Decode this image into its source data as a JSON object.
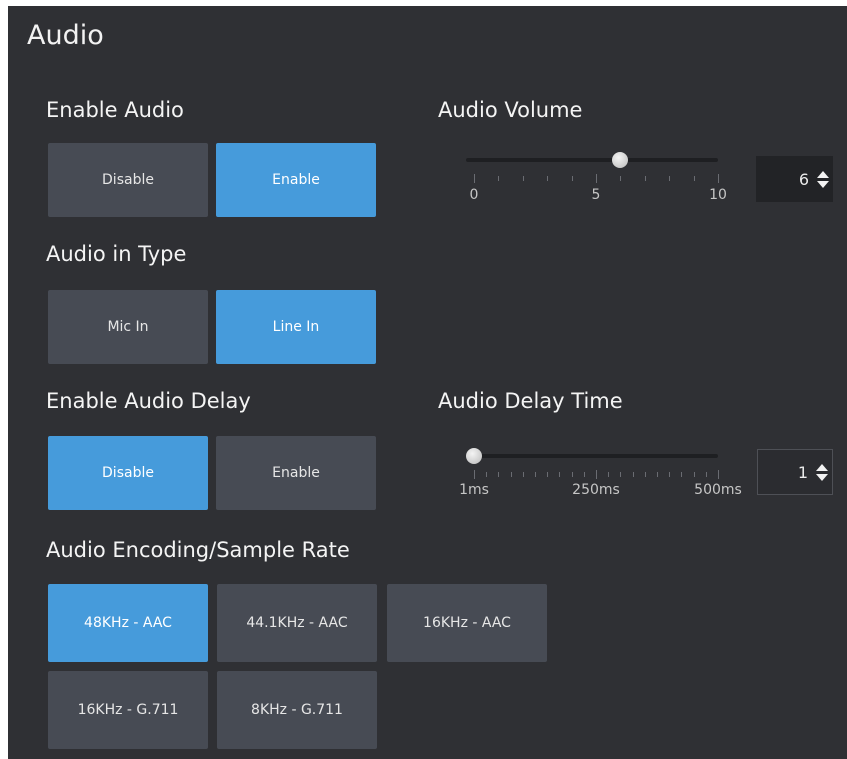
{
  "title": "Audio",
  "enable_audio": {
    "label": "Enable Audio",
    "options": [
      "Disable",
      "Enable"
    ],
    "selected": "Enable"
  },
  "audio_in_type": {
    "label": "Audio in Type",
    "options": [
      "Mic In",
      "Line In"
    ],
    "selected": "Line In"
  },
  "enable_audio_delay": {
    "label": "Enable Audio Delay",
    "options": [
      "Disable",
      "Enable"
    ],
    "selected": "Disable"
  },
  "audio_volume": {
    "label": "Audio Volume",
    "min": 0,
    "max": 10,
    "value": 6,
    "tick_labels": [
      "0",
      "5",
      "10"
    ],
    "value_text": "6"
  },
  "audio_delay_time": {
    "label": "Audio Delay Time",
    "min": 1,
    "max": 500,
    "value": 1,
    "tick_labels": [
      "1ms",
      "250ms",
      "500ms"
    ],
    "value_text": "1"
  },
  "encoding": {
    "label": "Audio Encoding/Sample Rate",
    "options": [
      "48KHz - AAC",
      "44.1KHz - AAC",
      "16KHz - AAC",
      "16KHz - G.711",
      "8KHz - G.711"
    ],
    "selected": "48KHz - AAC"
  },
  "icons": {
    "spinner_up": "arrow-up-icon",
    "spinner_down": "arrow-down-icon"
  }
}
